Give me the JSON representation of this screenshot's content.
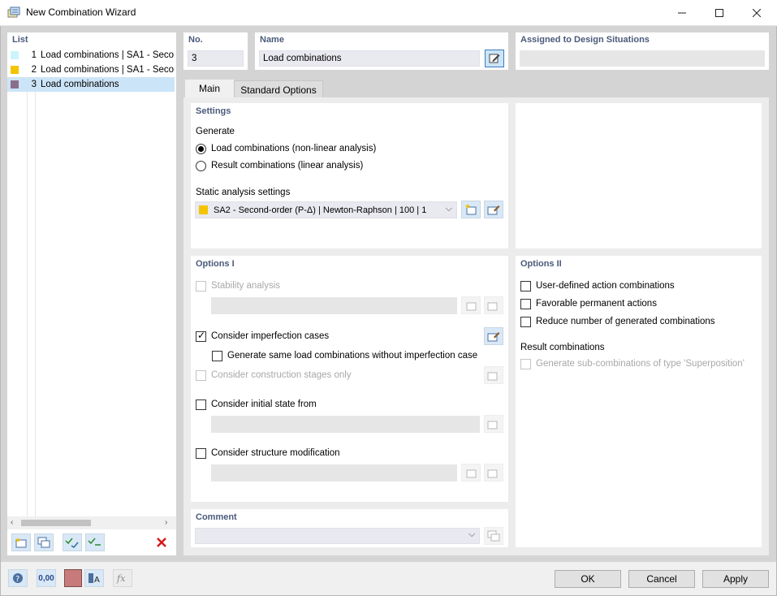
{
  "window": {
    "title": "New Combination Wizard"
  },
  "list": {
    "header": "List",
    "items": [
      {
        "num": "1",
        "label": "Load combinations | SA1 - Secon",
        "color": "#ccf5fb"
      },
      {
        "num": "2",
        "label": "Load combinations | SA1 - Secon",
        "color": "#f3c400"
      },
      {
        "num": "3",
        "label": "Load combinations",
        "color": "#8a6f8c",
        "selected": true
      }
    ]
  },
  "header": {
    "no_label": "No.",
    "no_value": "3",
    "name_label": "Name",
    "name_value": "Load combinations",
    "assigned_label": "Assigned to Design Situations",
    "assigned_value": ""
  },
  "tabs": [
    {
      "label": "Main",
      "active": true
    },
    {
      "label": "Standard Options",
      "active": false
    }
  ],
  "settings": {
    "header": "Settings",
    "generate_label": "Generate",
    "radio_load": "Load combinations (non-linear analysis)",
    "radio_result": "Result combinations (linear analysis)",
    "static_label": "Static analysis settings",
    "static_value": "SA2 - Second-order (P-Δ) | Newton-Raphson | 100 | 1",
    "static_color": "#f3c400"
  },
  "options1": {
    "header": "Options I",
    "stability": "Stability analysis",
    "imperfection": "Consider imperfection cases",
    "same_without": "Generate same load combinations without imperfection case",
    "construction": "Consider construction stages only",
    "initial_state": "Consider initial state from",
    "structure_mod": "Consider structure modification"
  },
  "options2": {
    "header": "Options II",
    "user_defined": "User-defined action combinations",
    "favorable": "Favorable permanent actions",
    "reduce": "Reduce number of generated combinations",
    "result_header": "Result combinations",
    "sub_combinations": "Generate sub-combinations of type 'Superposition'"
  },
  "comment": {
    "header": "Comment",
    "value": ""
  },
  "buttons": {
    "ok": "OK",
    "cancel": "Cancel",
    "apply": "Apply"
  },
  "bottom": {
    "decimal_label": "0,00"
  }
}
